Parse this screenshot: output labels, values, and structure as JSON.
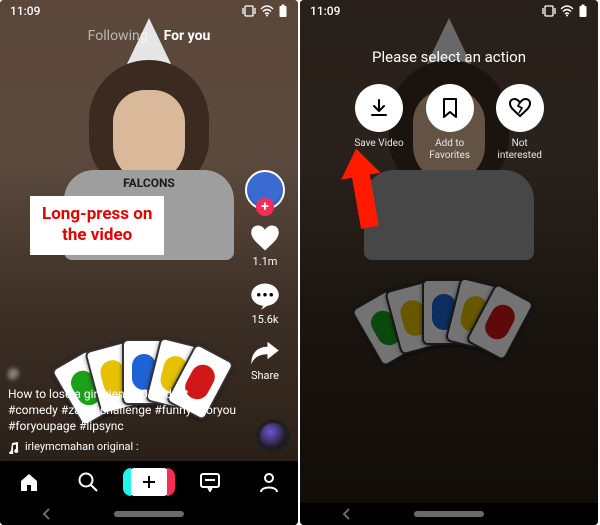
{
  "status": {
    "time": "11:09"
  },
  "left": {
    "tabs": {
      "following": "Following",
      "for_you": "For you"
    },
    "callout_line1": "Long-press on",
    "callout_line2": "the video",
    "rail": {
      "likes": "1.1m",
      "comments": "15.6k",
      "share": "Share"
    },
    "caption": {
      "handle": "@",
      "description": "How to lose a girlfriend 101 #duet #comedy #zankuchallenge #funny #foryou #foryoupage #lipsync",
      "sound": "irleymcmahan   original :"
    },
    "shirt_text": "FALCONS"
  },
  "right": {
    "title": "Please select an action",
    "actions": {
      "save": "Save Video",
      "favorite_l1": "Add to",
      "favorite_l2": "Favorites",
      "notinterested_l1": "Not",
      "notinterested_l2": "interested"
    }
  }
}
